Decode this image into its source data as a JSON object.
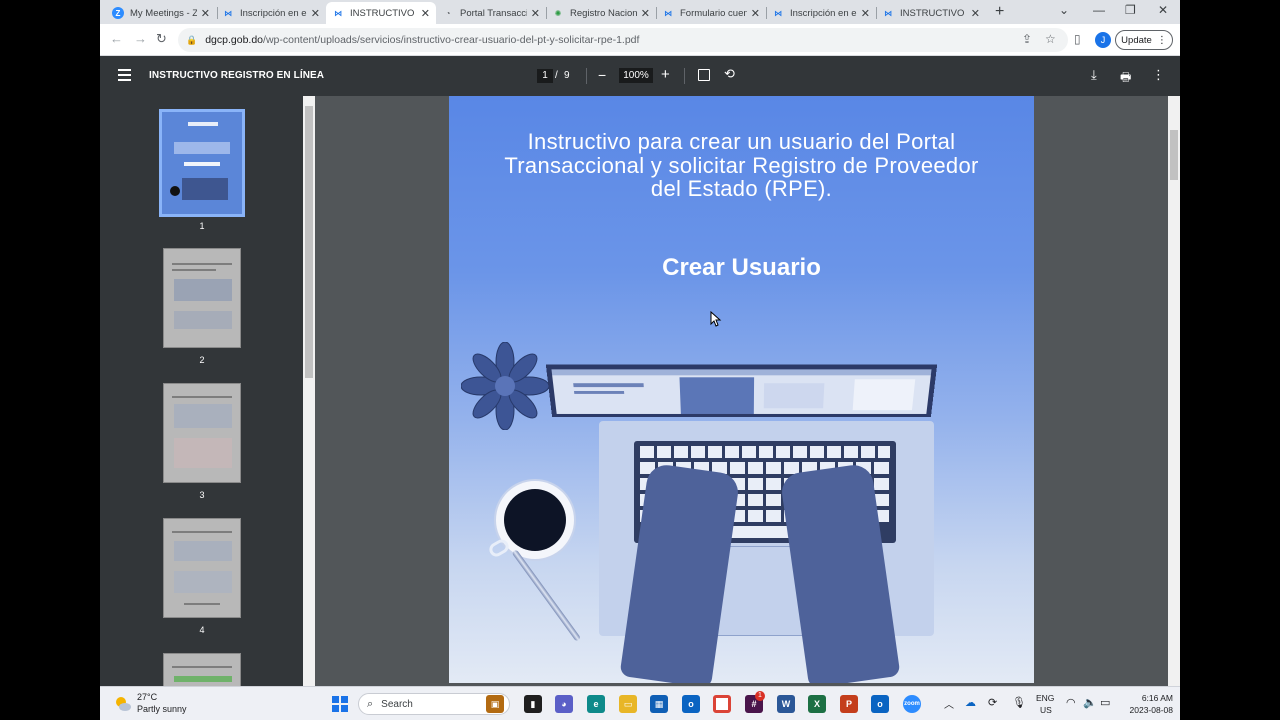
{
  "tabs": [
    {
      "title": "My Meetings - Z",
      "favicon": "zoom-icon"
    },
    {
      "title": "Inscripción en el",
      "favicon": "dgcp-icon"
    },
    {
      "title": "INSTRUCTIVO RI",
      "favicon": "dgcp-icon",
      "active": true
    },
    {
      "title": "Portal Transacci",
      "favicon": "portal-icon"
    },
    {
      "title": "Registro Nacion",
      "favicon": "globe-icon"
    },
    {
      "title": "Formulario cuen",
      "favicon": "dgcp-icon"
    },
    {
      "title": "Inscripción en el",
      "favicon": "dgcp-icon"
    },
    {
      "title": "INSTRUCTIVO RI",
      "favicon": "dgcp-icon"
    }
  ],
  "address": {
    "host": "dgcp.gob.do",
    "path": "/wp-content/uploads/servicios/instructivo-crear-usuario-del-pt-y-solicitar-rpe-1.pdf"
  },
  "toolbar": {
    "avatar_letter": "J",
    "update_label": "Update"
  },
  "pdf": {
    "title": "INSTRUCTIVO REGISTRO EN LÍNEA",
    "current_page": "1",
    "page_separator": "/",
    "total_pages": "9",
    "zoom": "100%",
    "thumbnails": [
      "1",
      "2",
      "3",
      "4"
    ]
  },
  "document": {
    "title": "Instructivo para crear un usuario del Portal Transaccional y solicitar Registro de Proveedor del Estado (RPE).",
    "heading": "Crear Usuario"
  },
  "taskbar": {
    "temperature": "27°C",
    "weather": "Partly sunny",
    "search_label": "Search",
    "lang_primary": "ENG",
    "lang_secondary": "US",
    "time": "6:16 AM",
    "date": "2023-08-08",
    "notification_badge": "1"
  },
  "colors": {
    "pdf_toolbar": "#323639",
    "pdf_viewport": "#525659",
    "page_blue": "#5987e6",
    "tab_strip": "#dee1e6"
  }
}
